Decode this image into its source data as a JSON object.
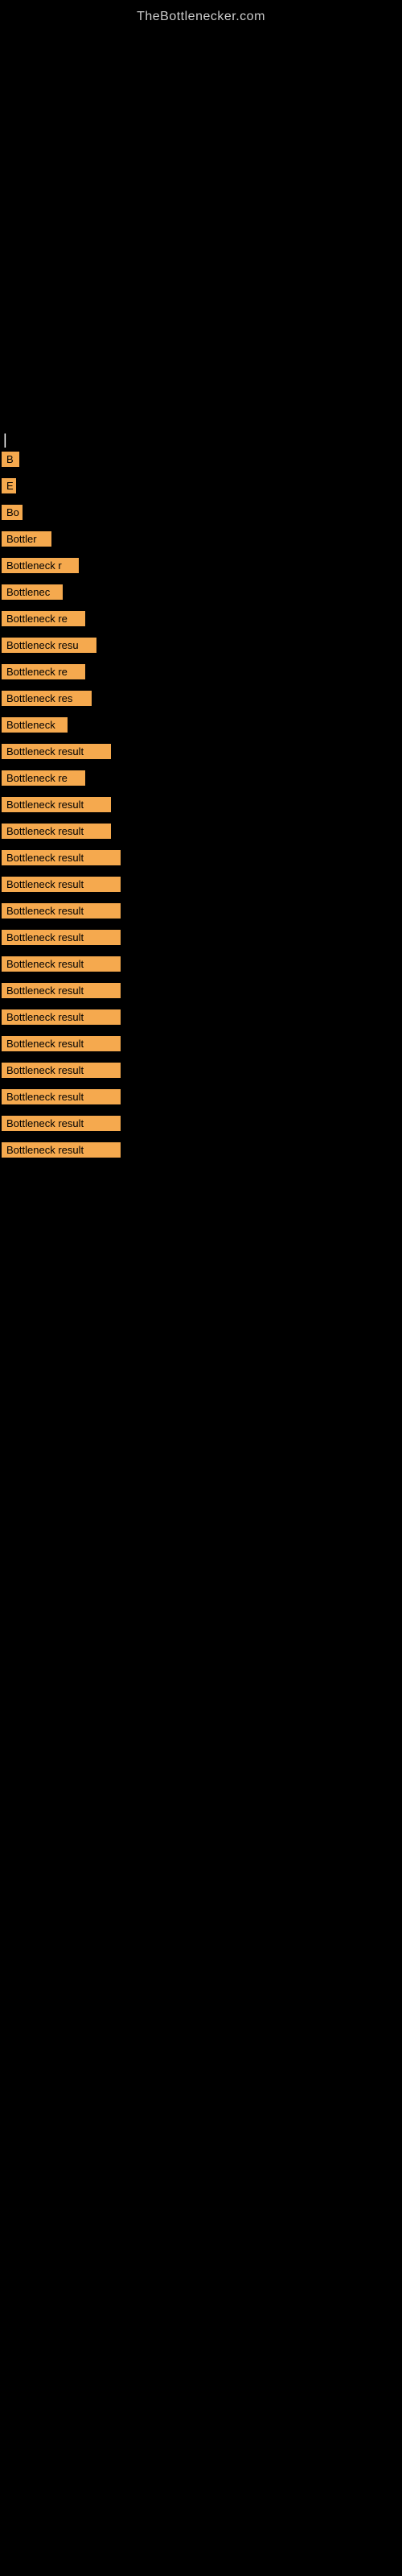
{
  "site": {
    "title": "TheBottlenecker.com"
  },
  "cursor": "|",
  "results": [
    {
      "id": 1,
      "label": "B",
      "width": 22
    },
    {
      "id": 2,
      "label": "E",
      "width": 18
    },
    {
      "id": 3,
      "label": "Bо",
      "width": 26
    },
    {
      "id": 4,
      "label": "Bottler",
      "width": 62
    },
    {
      "id": 5,
      "label": "Bottleneck r",
      "width": 96
    },
    {
      "id": 6,
      "label": "Bottlenec",
      "width": 76
    },
    {
      "id": 7,
      "label": "Bottleneck re",
      "width": 104
    },
    {
      "id": 8,
      "label": "Bottleneck resu",
      "width": 118
    },
    {
      "id": 9,
      "label": "Bottleneck re",
      "width": 104
    },
    {
      "id": 10,
      "label": "Bottleneck res",
      "width": 112
    },
    {
      "id": 11,
      "label": "Bottleneck",
      "width": 82
    },
    {
      "id": 12,
      "label": "Bottleneck result",
      "width": 136
    },
    {
      "id": 13,
      "label": "Bottleneck re",
      "width": 104
    },
    {
      "id": 14,
      "label": "Bottleneck result",
      "width": 136
    },
    {
      "id": 15,
      "label": "Bottleneck result",
      "width": 136
    },
    {
      "id": 16,
      "label": "Bottleneck result",
      "width": 148
    },
    {
      "id": 17,
      "label": "Bottleneck result",
      "width": 148
    },
    {
      "id": 18,
      "label": "Bottleneck result",
      "width": 148
    },
    {
      "id": 19,
      "label": "Bottleneck result",
      "width": 148
    },
    {
      "id": 20,
      "label": "Bottleneck result",
      "width": 148
    },
    {
      "id": 21,
      "label": "Bottleneck result",
      "width": 148
    },
    {
      "id": 22,
      "label": "Bottleneck result",
      "width": 148
    },
    {
      "id": 23,
      "label": "Bottleneck result",
      "width": 148
    },
    {
      "id": 24,
      "label": "Bottleneck result",
      "width": 148
    },
    {
      "id": 25,
      "label": "Bottleneck result",
      "width": 148
    },
    {
      "id": 26,
      "label": "Bottleneck result",
      "width": 148
    },
    {
      "id": 27,
      "label": "Bottleneck result",
      "width": 148
    }
  ]
}
